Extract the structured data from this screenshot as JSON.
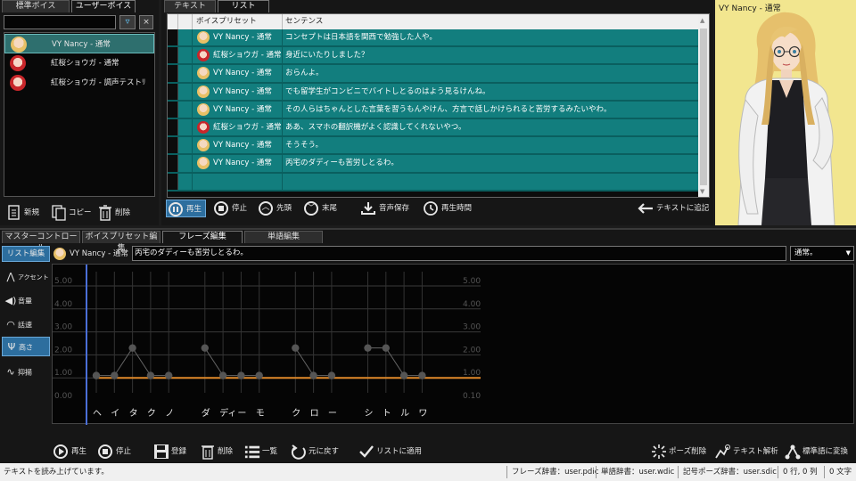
{
  "voice_panel": {
    "tabs": [
      "標準ボイス",
      "ユーザーボイス"
    ],
    "search_value": "",
    "items": [
      {
        "label": "VY Nancy - 通常",
        "avatar": "nancy",
        "selected": true
      },
      {
        "label": "紅桜ショウガ - 通常",
        "avatar": "shouga",
        "selected": false
      },
      {
        "label": "紅桜ショウガ - 調声テストﾘ",
        "avatar": "shouga",
        "selected": false
      }
    ],
    "buttons": {
      "new": "新規",
      "copy": "コピー",
      "delete": "削除"
    }
  },
  "list_panel": {
    "tabs": [
      "テキスト",
      "リスト"
    ],
    "columns": [
      "ボイスプリセット",
      "センテンス"
    ],
    "rows": [
      {
        "preset": "VY Nancy - 通常",
        "avatar": "nancy",
        "text": "コンセプトは日本語を関西で勉強した人や。"
      },
      {
        "preset": "紅桜ショウガ - 通常",
        "avatar": "shouga",
        "text": "身近にいたりしました？"
      },
      {
        "preset": "VY Nancy - 通常",
        "avatar": "nancy",
        "text": "おらんよ。"
      },
      {
        "preset": "VY Nancy - 通常",
        "avatar": "nancy",
        "text": "でも留学生がコンビニでバイトしとるのはよう見るけんね。"
      },
      {
        "preset": "VY Nancy - 通常",
        "avatar": "nancy",
        "text": "その人らはちゃんとした言葉を習うもんやけん、方言で話しかけられると苦労するみたいやわ。"
      },
      {
        "preset": "紅桜ショウガ - 通常",
        "avatar": "shouga",
        "text": "ああ、スマホの翻訳機がよく認識してくれないやつ。"
      },
      {
        "preset": "VY Nancy - 通常",
        "avatar": "nancy",
        "text": "そうそう。"
      },
      {
        "preset": "VY Nancy - 通常",
        "avatar": "nancy",
        "text": "丙宅のダディーも苦労しとるわ。"
      },
      {
        "preset": "",
        "avatar": "",
        "text": ""
      }
    ],
    "controls": {
      "play": "再生",
      "stop": "停止",
      "head": "先頭",
      "tail": "末尾",
      "save_audio": "音声保存",
      "play_time": "再生時間",
      "append_text": "テキストに追記"
    }
  },
  "portrait": {
    "title": "VY Nancy - 通常"
  },
  "editor": {
    "tabs": [
      "マスターコントロール",
      "ボイスプリセット編集",
      "フレーズ編集",
      "単語編集"
    ],
    "list_edit_button": "リスト編集",
    "speaker": "VY Nancy - 通常",
    "phrase_text": "丙宅のダディーも苦労しとるわ。",
    "style_value": "通常。",
    "sidebar": [
      {
        "label": "アクセント",
        "icon": "accent-icon"
      },
      {
        "label": "音量",
        "icon": "volume-icon"
      },
      {
        "label": "話速",
        "icon": "speed-icon"
      },
      {
        "label": "高さ",
        "icon": "pitch-icon",
        "selected": true
      },
      {
        "label": "抑揚",
        "icon": "intonation-icon"
      }
    ],
    "y_ticks_left": [
      "5.00",
      "4.00",
      "3.00",
      "2.00",
      "1.00",
      "0.00"
    ],
    "y_ticks_right": [
      "5.00",
      "4.00",
      "3.00",
      "2.00",
      "1.00",
      "0.10"
    ],
    "kana": [
      "ヘ",
      "イ",
      "タ",
      "ク",
      "ノ",
      "",
      "ダ",
      "ディ",
      "ー",
      "モ",
      "",
      "ク",
      "ロ",
      "ー",
      "",
      "シ",
      "ト",
      "ル",
      "ワ"
    ],
    "points": [
      1.1,
      1.1,
      2.3,
      1.1,
      1.1,
      null,
      2.3,
      1.1,
      1.1,
      1.1,
      null,
      2.3,
      1.1,
      1.1,
      null,
      2.3,
      2.3,
      1.1,
      1.1
    ],
    "baseline": 1.0,
    "bottom_controls": {
      "play": "再生",
      "stop": "停止",
      "register": "登録",
      "delete": "削除",
      "list": "一覧",
      "undo": "元に戻す",
      "apply_list": "リストに適用",
      "pause_delete": "ポーズ削除",
      "text_analyze": "テキスト解析",
      "to_standard": "標準語に変換"
    }
  },
  "statusbar": {
    "message": "テキストを読み上げています。",
    "phrase_dict": "フレーズ辞書：user.pdic",
    "word_dict": "単語辞書：user.wdic",
    "symbol_dict": "記号ポーズ辞書：user.sdic",
    "position": "0 行, 0 列",
    "chars": "0 文字"
  },
  "colors": {
    "row": "#127e7e",
    "selected": "#2e6f6e",
    "baseline": "#e08a2a",
    "cursor": "#4a6fd8",
    "portrait_bg": "#f2e68f"
  }
}
